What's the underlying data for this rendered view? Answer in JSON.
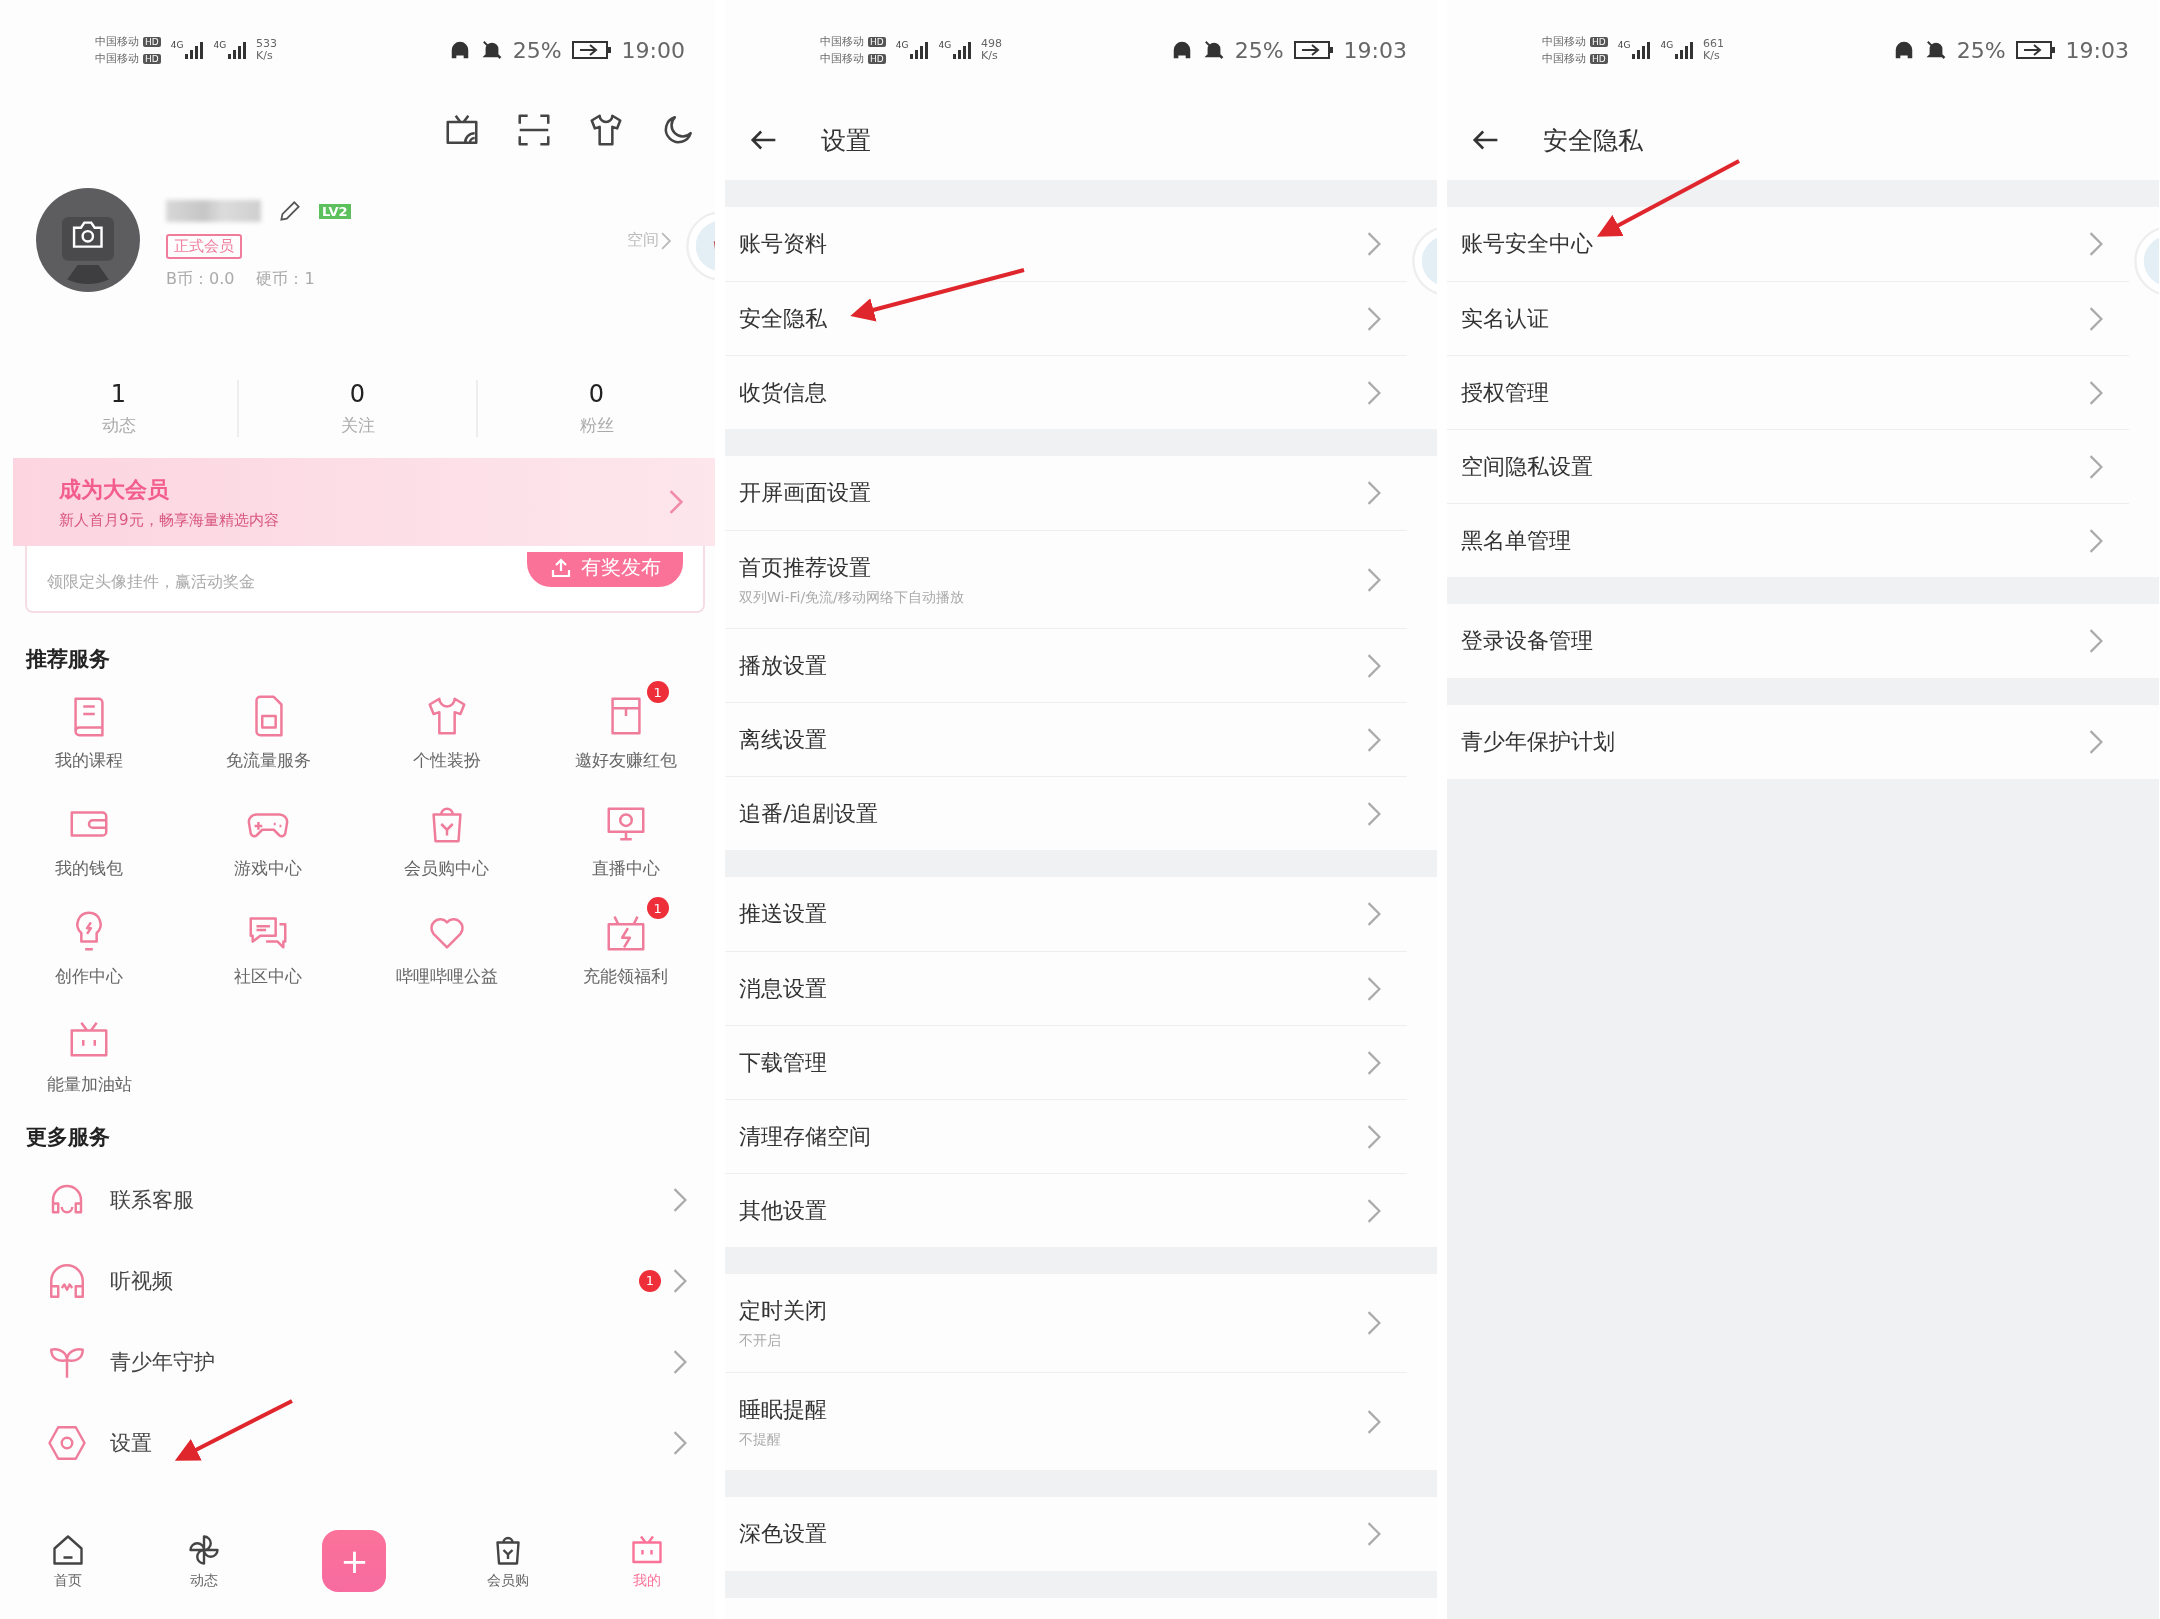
{
  "screens": [
    {
      "kind": "profile",
      "status_bar": {
        "carriers": [
          {
            "name": "中国移动",
            "badge": "HD"
          },
          {
            "name": "中国移动",
            "badge": "HD"
          }
        ],
        "networks": [
          "4G",
          "4G"
        ],
        "speed": "533",
        "speed_unit": "K/s",
        "battery": "25%",
        "time": "19:00"
      },
      "level_badge": "LV2",
      "member_tag": "正式会员",
      "b_coins": "B币：0.0",
      "coins": "硬币：1",
      "space_link": "空间",
      "stats": [
        {
          "value": "1",
          "label": "动态"
        },
        {
          "value": "0",
          "label": "关注"
        },
        {
          "value": "0",
          "label": "粉丝"
        }
      ],
      "vip_banner": {
        "title": "成为大会员",
        "subtitle": "新人首月9元，畅享海量精选内容"
      },
      "promo_card": {
        "subtitle": "领限定头像挂件，赢活动奖金",
        "button": "有奖发布"
      },
      "recommended": {
        "title": "推荐服务",
        "items": [
          {
            "label": "我的课程"
          },
          {
            "label": "免流量服务"
          },
          {
            "label": "个性装扮"
          },
          {
            "label": "邀好友赚红包",
            "badge": "1"
          },
          {
            "label": "我的钱包"
          },
          {
            "label": "游戏中心"
          },
          {
            "label": "会员购中心"
          },
          {
            "label": "直播中心"
          },
          {
            "label": "创作中心"
          },
          {
            "label": "社区中心"
          },
          {
            "label": "哔哩哔哩公益"
          },
          {
            "label": "充能领福利",
            "badge": "1"
          },
          {
            "label": "能量加油站"
          }
        ]
      },
      "more_services": {
        "title": "更多服务",
        "items": [
          {
            "label": "联系客服"
          },
          {
            "label": "听视频",
            "badge": "1"
          },
          {
            "label": "青少年守护"
          },
          {
            "label": "设置"
          }
        ]
      },
      "bottom_nav": [
        {
          "label": "首页",
          "selected": false
        },
        {
          "label": "动态",
          "selected": false
        },
        {
          "kind": "plus",
          "label": "+"
        },
        {
          "label": "会员购",
          "selected": false
        },
        {
          "label": "我的",
          "selected": true
        }
      ]
    },
    {
      "kind": "settings",
      "status_bar": {
        "carriers": [
          {
            "name": "中国移动",
            "badge": "HD"
          },
          {
            "name": "中国移动",
            "badge": "HD"
          }
        ],
        "networks": [
          "4G",
          "4G"
        ],
        "speed": "498",
        "speed_unit": "K/s",
        "battery": "25%",
        "time": "19:03"
      },
      "title": "设置",
      "fill_grey": false,
      "groups": [
        {
          "items": [
            {
              "label": "账号资料"
            },
            {
              "label": "安全隐私"
            },
            {
              "label": "收货信息"
            }
          ]
        },
        {
          "items": [
            {
              "label": "开屏画面设置"
            },
            {
              "label": "首页推荐设置",
              "subtitle": "双列Wi-Fi/免流/移动网络下自动播放"
            },
            {
              "label": "播放设置"
            },
            {
              "label": "离线设置"
            },
            {
              "label": "追番/追剧设置"
            }
          ]
        },
        {
          "items": [
            {
              "label": "推送设置"
            },
            {
              "label": "消息设置"
            },
            {
              "label": "下载管理"
            },
            {
              "label": "清理存储空间"
            },
            {
              "label": "其他设置"
            }
          ]
        },
        {
          "items": [
            {
              "label": "定时关闭",
              "subtitle": "不开启"
            },
            {
              "label": "睡眠提醒",
              "subtitle": "不提醒"
            }
          ]
        },
        {
          "items": [
            {
              "label": "深色设置"
            }
          ]
        }
      ]
    },
    {
      "kind": "settings",
      "status_bar": {
        "carriers": [
          {
            "name": "中国移动",
            "badge": "HD"
          },
          {
            "name": "中国移动",
            "badge": "HD"
          }
        ],
        "networks": [
          "4G",
          "4G"
        ],
        "speed": "661",
        "speed_unit": "K/s",
        "battery": "25%",
        "time": "19:03"
      },
      "title": "安全隐私",
      "fill_grey": true,
      "groups": [
        {
          "items": [
            {
              "label": "账号安全中心"
            },
            {
              "label": "实名认证"
            },
            {
              "label": "授权管理"
            },
            {
              "label": "空间隐私设置"
            },
            {
              "label": "黑名单管理"
            }
          ]
        },
        {
          "items": [
            {
              "label": "登录设备管理"
            }
          ]
        },
        {
          "items": [
            {
              "label": "青少年保护计划"
            }
          ]
        }
      ]
    }
  ]
}
